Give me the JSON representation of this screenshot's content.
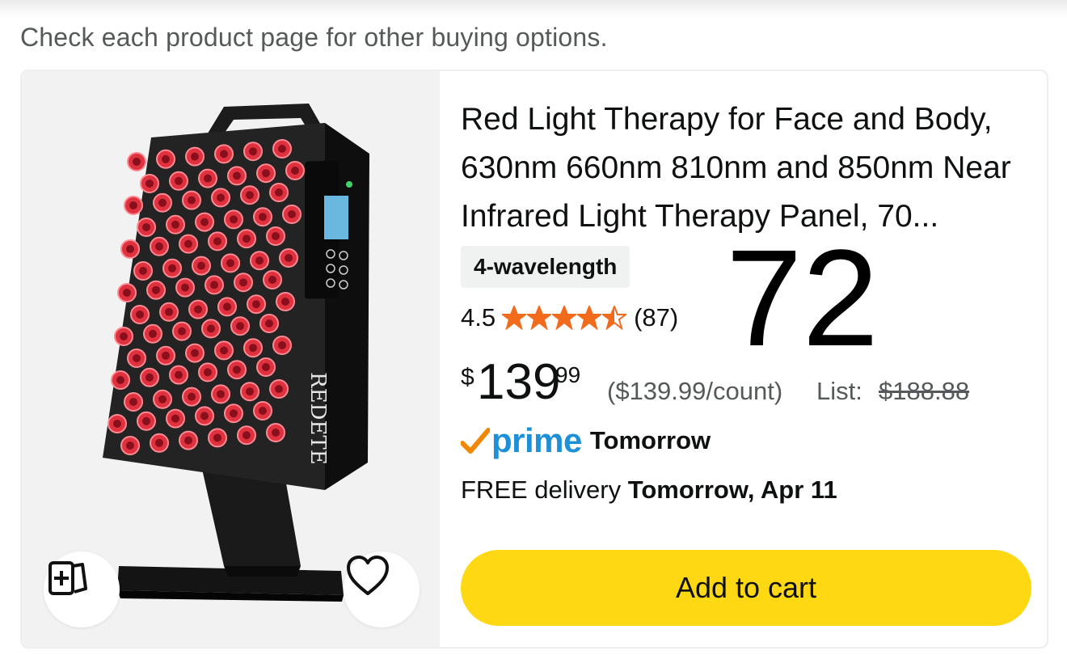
{
  "notice": "Check each product page for other buying options.",
  "product": {
    "title": "Red Light Therapy for Face and Body, 630nm 660nm 810nm and 850nm Near Infrared Light Therapy Panel, 70...",
    "brand_on_device": "REDETE",
    "variant": "4-wavelength",
    "overlay_number": "72",
    "rating": {
      "value": "4.5",
      "stars": 4.5,
      "count": "(87)",
      "star_color": "#f26a1b"
    },
    "price": {
      "symbol": "$",
      "whole": "139",
      "fraction": "99",
      "unit_price": "($139.99/count)",
      "list_label": "List:",
      "list_price": "$188.88"
    },
    "prime": {
      "logo_text": "prime",
      "when": "Tomorrow",
      "check_color": "#f08804",
      "text_color": "#1e90d8"
    },
    "delivery": {
      "prefix": "FREE delivery",
      "date": "Tomorrow, Apr 11"
    }
  },
  "buttons": {
    "add_to_cart": "Add to cart",
    "add_to_cart_color": "#ffd814",
    "compare_icon": "compare-cards-icon",
    "wishlist_icon": "heart-icon"
  }
}
